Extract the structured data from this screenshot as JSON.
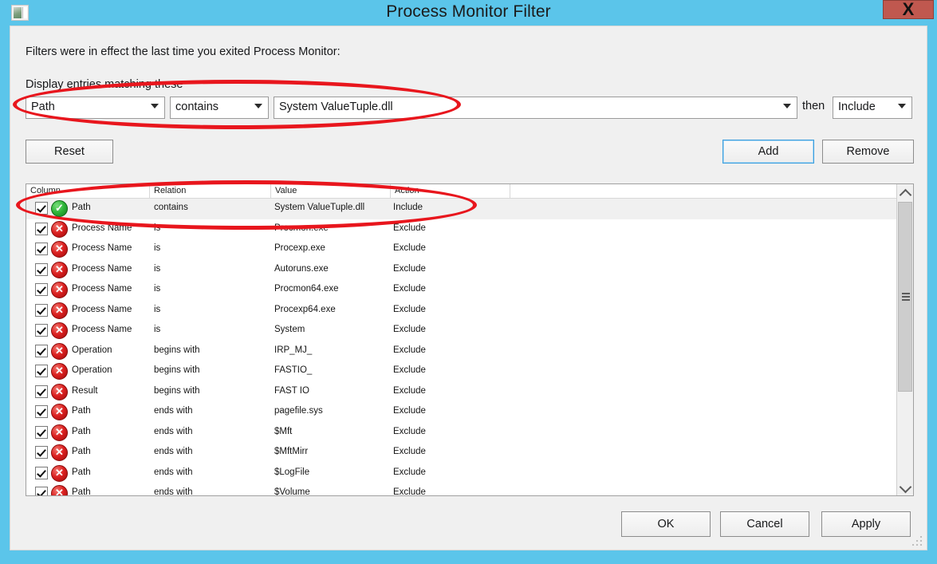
{
  "window": {
    "title": "Process Monitor Filter",
    "icon": "procmon-window-icon",
    "close_label": "X",
    "titlebar_color": "#5bc5ea",
    "close_color": "#c0584f"
  },
  "body": {
    "intro_text": "Filters were in effect the last time you exited Process Monitor:",
    "group_label": "Display entries matching these"
  },
  "filter_editor": {
    "column": "Path",
    "relation": "contains",
    "value": "System ValueTuple.dll",
    "then_label": "then",
    "action": "Include"
  },
  "buttons": {
    "reset": "Reset",
    "add": "Add",
    "remove": "Remove",
    "ok": "OK",
    "cancel": "Cancel",
    "apply": "Apply"
  },
  "list": {
    "headers": [
      "Column",
      "Relation",
      "Value",
      "Action"
    ],
    "rows": [
      {
        "checked": true,
        "kind": "include",
        "column": "Path",
        "relation": "contains",
        "value": "System ValueTuple.dll",
        "action": "Include",
        "selected": true
      },
      {
        "checked": true,
        "kind": "exclude",
        "column": "Process Name",
        "relation": "is",
        "value": "Procmon.exe",
        "action": "Exclude",
        "selected": false
      },
      {
        "checked": true,
        "kind": "exclude",
        "column": "Process Name",
        "relation": "is",
        "value": "Procexp.exe",
        "action": "Exclude",
        "selected": false
      },
      {
        "checked": true,
        "kind": "exclude",
        "column": "Process Name",
        "relation": "is",
        "value": "Autoruns.exe",
        "action": "Exclude",
        "selected": false
      },
      {
        "checked": true,
        "kind": "exclude",
        "column": "Process Name",
        "relation": "is",
        "value": "Procmon64.exe",
        "action": "Exclude",
        "selected": false
      },
      {
        "checked": true,
        "kind": "exclude",
        "column": "Process Name",
        "relation": "is",
        "value": "Procexp64.exe",
        "action": "Exclude",
        "selected": false
      },
      {
        "checked": true,
        "kind": "exclude",
        "column": "Process Name",
        "relation": "is",
        "value": "System",
        "action": "Exclude",
        "selected": false
      },
      {
        "checked": true,
        "kind": "exclude",
        "column": "Operation",
        "relation": "begins with",
        "value": "IRP_MJ_",
        "action": "Exclude",
        "selected": false
      },
      {
        "checked": true,
        "kind": "exclude",
        "column": "Operation",
        "relation": "begins with",
        "value": "FASTIO_",
        "action": "Exclude",
        "selected": false
      },
      {
        "checked": true,
        "kind": "exclude",
        "column": "Result",
        "relation": "begins with",
        "value": "FAST IO",
        "action": "Exclude",
        "selected": false
      },
      {
        "checked": true,
        "kind": "exclude",
        "column": "Path",
        "relation": "ends with",
        "value": "pagefile.sys",
        "action": "Exclude",
        "selected": false
      },
      {
        "checked": true,
        "kind": "exclude",
        "column": "Path",
        "relation": "ends with",
        "value": "$Mft",
        "action": "Exclude",
        "selected": false
      },
      {
        "checked": true,
        "kind": "exclude",
        "column": "Path",
        "relation": "ends with",
        "value": "$MftMirr",
        "action": "Exclude",
        "selected": false
      },
      {
        "checked": true,
        "kind": "exclude",
        "column": "Path",
        "relation": "ends with",
        "value": "$LogFile",
        "action": "Exclude",
        "selected": false
      },
      {
        "checked": true,
        "kind": "exclude",
        "column": "Path",
        "relation": "ends with",
        "value": "$Volume",
        "action": "Exclude",
        "selected": false
      }
    ]
  },
  "annotations": {
    "color": "#e8161d",
    "shapes": [
      "ellipse-around-filter-editor-row",
      "ellipse-around-first-list-row"
    ]
  }
}
